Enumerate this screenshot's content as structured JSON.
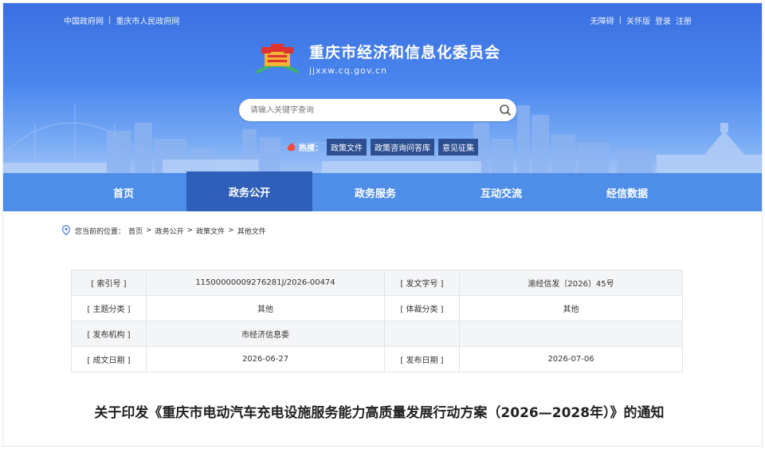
{
  "top_links": {
    "left": [
      "中国政府网",
      "重庆市人民政府网"
    ],
    "right": [
      "无障碍",
      "关怀版",
      "登录",
      "注册"
    ]
  },
  "logo": {
    "title": "重庆市经济和信息化委员会",
    "domain": "jjxxw.cq.gov.cn"
  },
  "search": {
    "placeholder": "请输入关键字查询"
  },
  "hot": {
    "label": "热搜：",
    "tags": [
      "政策文件",
      "政策咨询问答库",
      "意见征集"
    ]
  },
  "nav": {
    "items": [
      "首页",
      "政务公开",
      "政务服务",
      "互动交流",
      "经信数据"
    ],
    "active_index": 1
  },
  "breadcrumb": {
    "prefix": "您当前的位置：",
    "items": [
      "首页",
      "政务公开",
      "政策文件",
      "其他文件"
    ],
    "separator": ">"
  },
  "info_table": {
    "rows": [
      [
        "[ 索引号 ]",
        "11500000009276281J/2026-00474",
        "[ 发文字号 ]",
        "渝经信发〔2026〕45号"
      ],
      [
        "[ 主题分类 ]",
        "其他",
        "[ 体裁分类 ]",
        "其他"
      ],
      [
        "[ 发布机构 ]",
        "市经济信息委",
        "",
        ""
      ],
      [
        "[ 成文日期 ]",
        "2026-06-27",
        "[ 发布日期 ]",
        "2026-07-06"
      ]
    ]
  },
  "document": {
    "title": "关于印发《重庆市电动汽车充电设施服务能力高质量发展行动方案（2026—2028年）》的通知"
  },
  "colors": {
    "banner_top": "#3a6fe0",
    "nav": "#4f8ee8",
    "nav_active": "#2f5fb8",
    "hot_tag": "#2d4f92"
  }
}
